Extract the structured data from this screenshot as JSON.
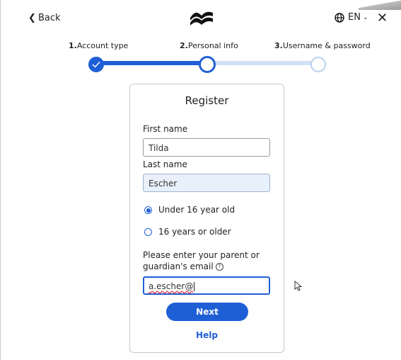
{
  "topbar": {
    "back_label": "Back",
    "language": "EN",
    "close_glyph": "✕"
  },
  "steps": [
    {
      "number": "1.",
      "label": "Account type",
      "state": "done"
    },
    {
      "number": "2.",
      "label": "Personal info",
      "state": "current"
    },
    {
      "number": "3.",
      "label": "Username & password",
      "state": "todo"
    }
  ],
  "form": {
    "title": "Register",
    "first_name_label": "First name",
    "first_name_value": "Tilda",
    "last_name_label": "Last name",
    "last_name_value": "Escher",
    "age_options": [
      {
        "label": "Under 16 year old",
        "selected": true
      },
      {
        "label": "16 years or older",
        "selected": false
      }
    ],
    "guardian_prompt": "Please enter your parent or guardian's email",
    "guardian_email_value": "a.escher@",
    "next_label": "Next",
    "help_label": "Help"
  },
  "colors": {
    "accent": "#1f5fd6",
    "track_inactive": "#cfe0f7",
    "filled_input": "#e8f0fb"
  },
  "icons": [
    "chevron-left-icon",
    "brand-logo-icon",
    "globe-icon",
    "chevron-down-icon",
    "close-icon",
    "check-icon",
    "help-circle-icon",
    "mouse-pointer-icon"
  ]
}
